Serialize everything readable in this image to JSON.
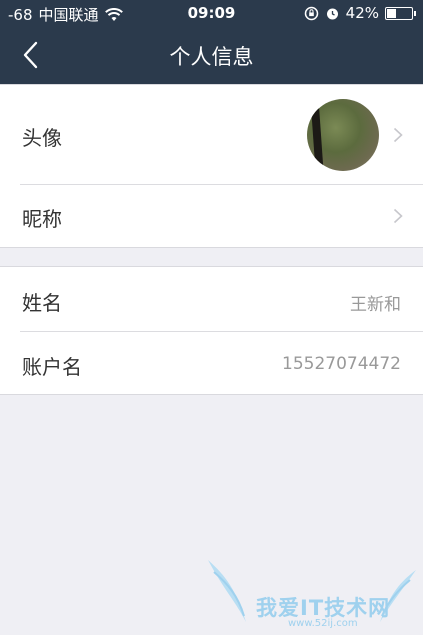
{
  "status_bar": {
    "signal": "-68",
    "carrier": "中国联通",
    "time": "09:09",
    "battery_percent": "42%",
    "battery_level": 0.42
  },
  "nav": {
    "title": "个人信息"
  },
  "profile_group": {
    "rows": [
      {
        "label": "头像"
      },
      {
        "label": "昵称"
      }
    ]
  },
  "info_group": {
    "rows": [
      {
        "label": "姓名",
        "value": "王新和"
      },
      {
        "label": "账户名",
        "value": "15527074472"
      }
    ]
  },
  "watermark": {
    "text": "我爱IT技术网",
    "url": "www.52ij.com"
  },
  "colors": {
    "navbar_bg": "#2b3a4c",
    "page_bg": "#efeff4"
  }
}
